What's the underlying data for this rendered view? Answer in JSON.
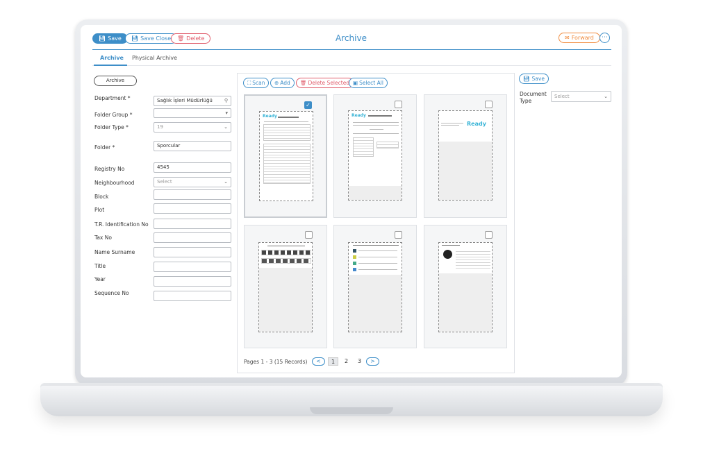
{
  "header": {
    "title": "Archive",
    "save_label": "Save",
    "save_close_label": "Save Close",
    "delete_label": "Delete",
    "forward_label": "Forward",
    "more_label": "⋯"
  },
  "tabs": [
    {
      "label": "Archive",
      "active": true
    },
    {
      "label": "Physical Archive",
      "active": false
    }
  ],
  "form": {
    "archive_button": "Archive",
    "fields": [
      {
        "label": "Department *",
        "value": "Sağlık İşleri Müdürlüğü"
      },
      {
        "label": "Folder Group *",
        "value": ""
      },
      {
        "label": "Folder Type *",
        "value": "19"
      },
      {
        "label": "Folder *",
        "value": "Sporcular"
      },
      {
        "label": "Registry No",
        "value": "4545"
      },
      {
        "label": "Neighbourhood",
        "value": "Select"
      },
      {
        "label": "Block",
        "value": ""
      },
      {
        "label": "Plot",
        "value": ""
      },
      {
        "label": "T.R. Identification No",
        "value": ""
      },
      {
        "label": "Tax No",
        "value": ""
      },
      {
        "label": "Name Surname",
        "value": ""
      },
      {
        "label": "Title",
        "value": ""
      },
      {
        "label": "Year",
        "value": ""
      },
      {
        "label": "Sequence No",
        "value": ""
      }
    ]
  },
  "toolbar": {
    "scan": "Scan",
    "add": "Add",
    "delete_selected": "Delete Selected",
    "select_all": "Select All"
  },
  "documents": [
    {
      "checked": true,
      "kind": "table",
      "logo": "Ready"
    },
    {
      "checked": false,
      "kind": "form",
      "logo": "Ready"
    },
    {
      "checked": false,
      "kind": "letter",
      "logo": "Ready"
    },
    {
      "checked": false,
      "kind": "photos"
    },
    {
      "checked": false,
      "kind": "list"
    },
    {
      "checked": false,
      "kind": "article"
    }
  ],
  "pagination": {
    "text": "Pages 1 - 3 (15 Records)",
    "prev": "<",
    "next": ">",
    "pages": [
      "1",
      "2",
      "3"
    ],
    "current": "1"
  },
  "right_panel": {
    "save_label": "Save",
    "document_type_label": "Document Type",
    "document_type_value": "Select"
  },
  "colors": {
    "accent": "#3d8ec8",
    "danger": "#e05b6a",
    "forward": "#f08a3c"
  }
}
